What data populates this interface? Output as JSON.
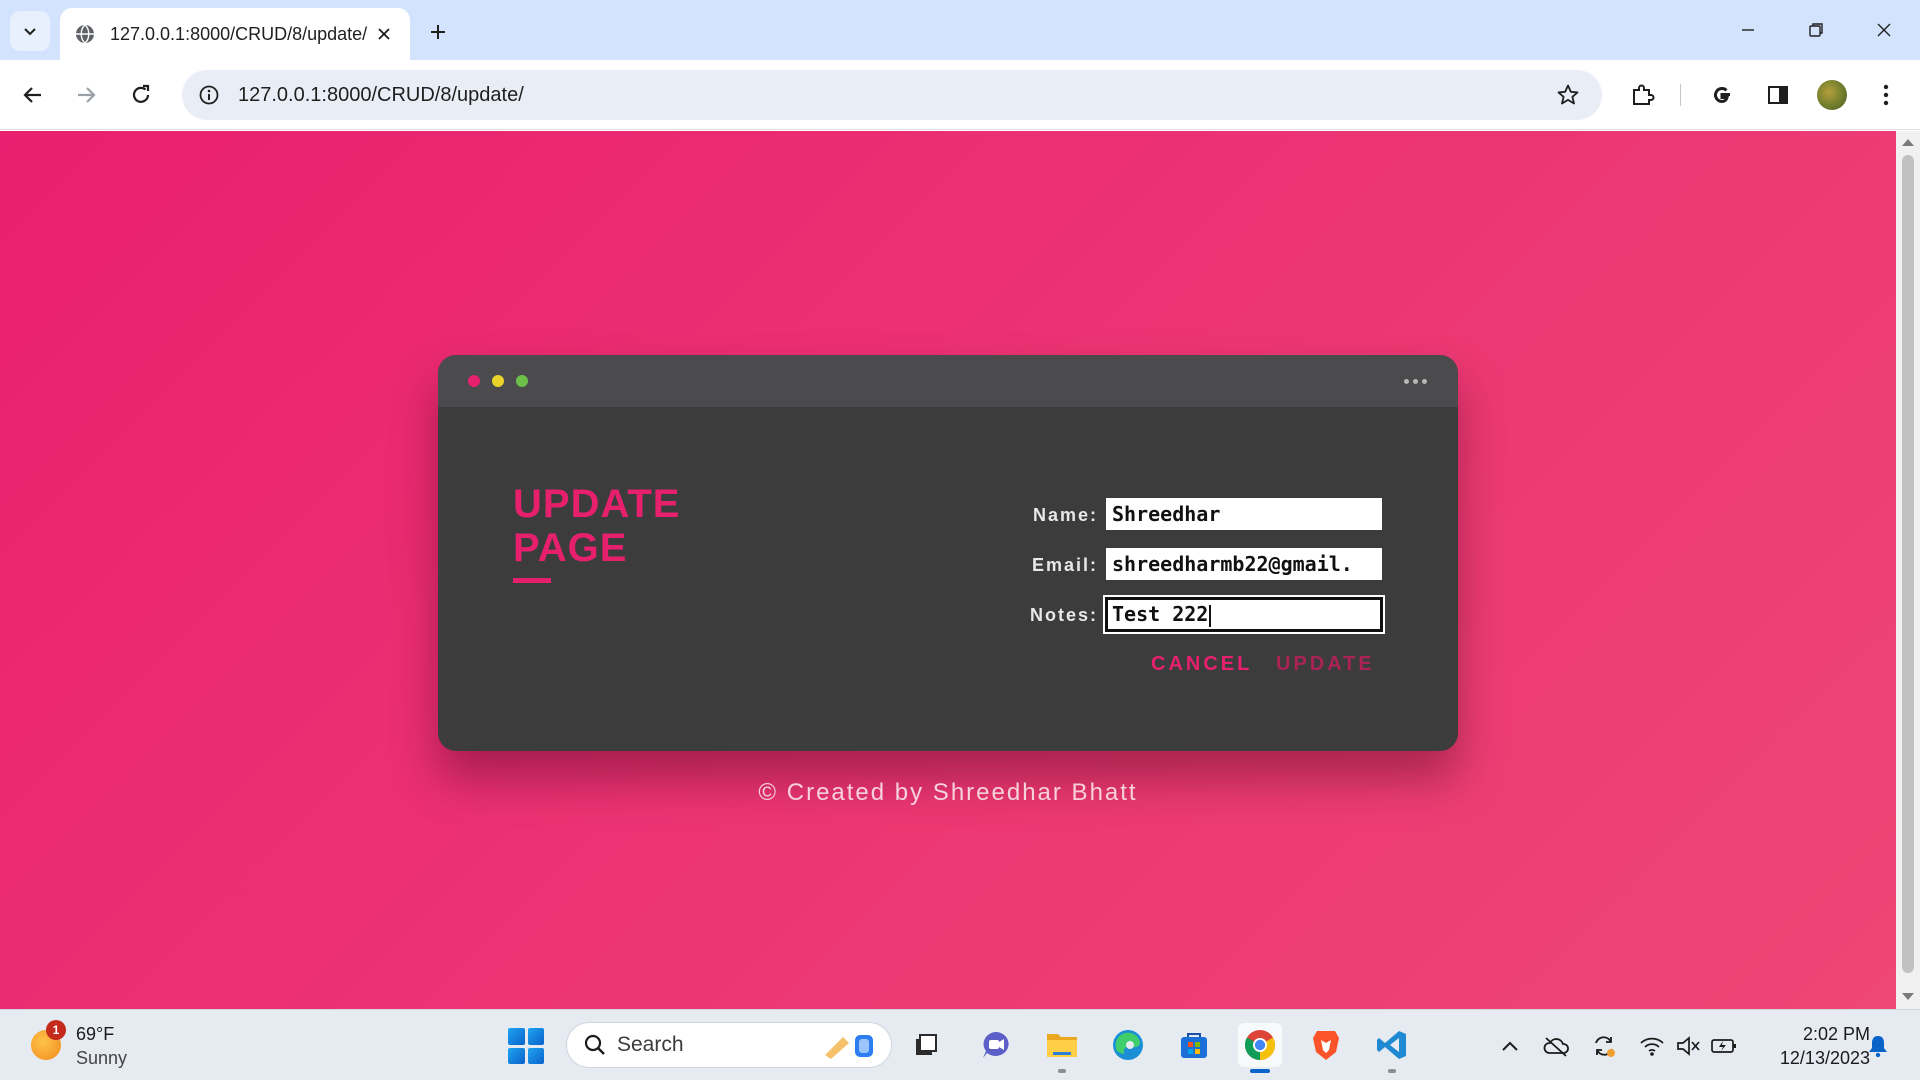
{
  "browser": {
    "tab_title": "127.0.0.1:8000/CRUD/8/update/",
    "url": "127.0.0.1:8000/CRUD/8/update/"
  },
  "page": {
    "heading_line1": "UPDATE",
    "heading_line2": "PAGE",
    "form": {
      "name_label": "Name:",
      "name_value": "Shreedhar",
      "email_label": "Email:",
      "email_value": "shreedharmb22@gmail.",
      "notes_label": "Notes:",
      "notes_value": "Test 222"
    },
    "cancel_label": "CANCEL",
    "update_label": "UPDATE",
    "credit": "© Created by Shreedhar Bhatt",
    "colors": {
      "accent": "#e6206d",
      "card": "#3c3c3d",
      "dot_red": "#e6206d",
      "dot_yellow": "#e8d42a",
      "dot_green": "#6cc04a"
    }
  },
  "taskbar": {
    "weather_badge": "1",
    "temperature": "69°F",
    "condition": "Sunny",
    "search_label": "Search",
    "time": "2:02 PM",
    "date": "12/13/2023"
  }
}
